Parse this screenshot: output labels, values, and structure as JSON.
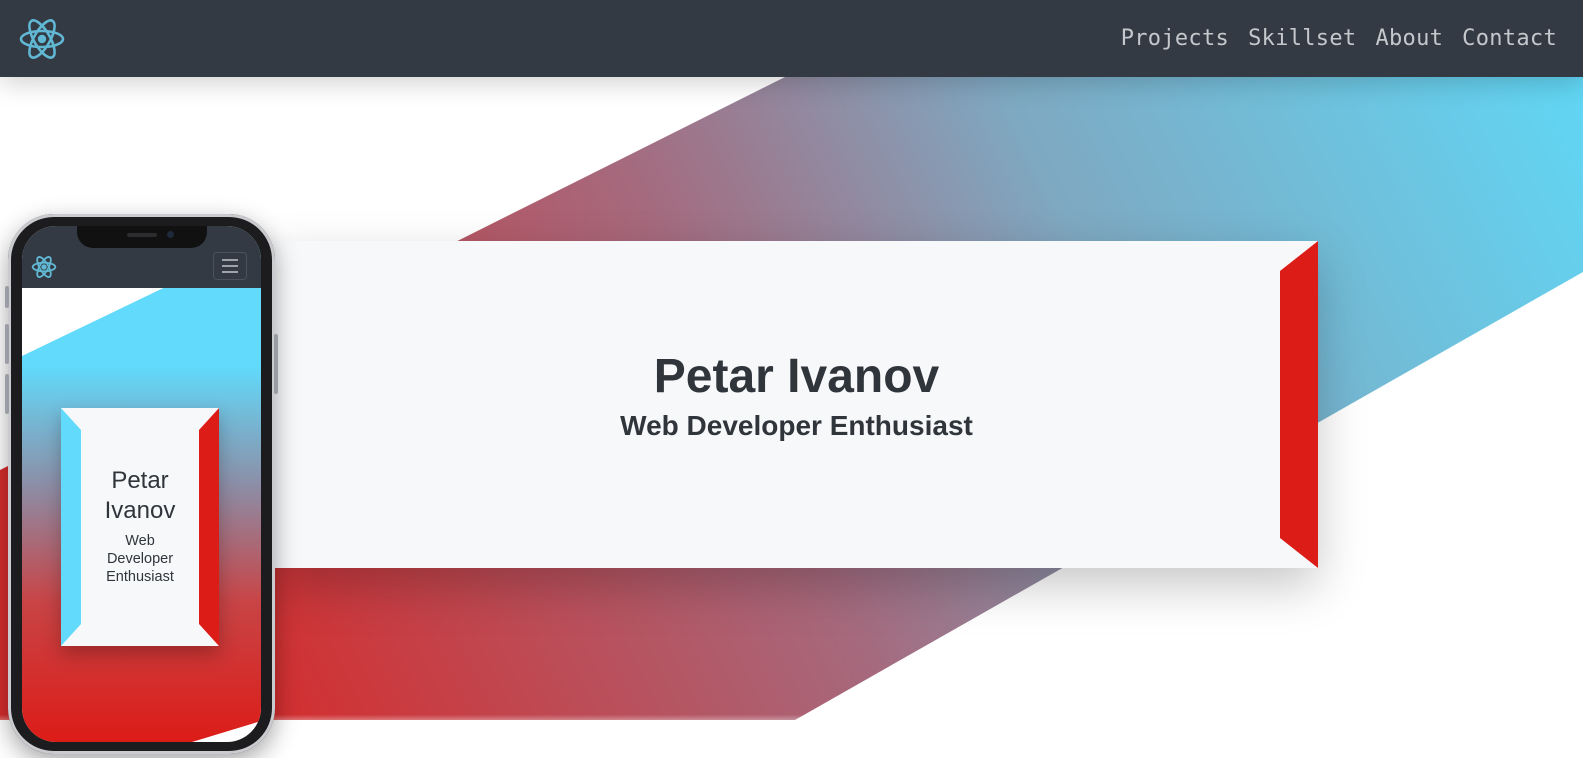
{
  "nav": {
    "logo_icon": "react-atom-icon",
    "items": [
      {
        "label": "Projects"
      },
      {
        "label": "Skillset"
      },
      {
        "label": "About"
      },
      {
        "label": "Contact"
      }
    ]
  },
  "hero": {
    "name": "Petar Ivanov",
    "role": "Web Developer Enthusiast"
  },
  "phone_preview": {
    "logo_icon": "react-atom-icon",
    "menu_icon": "hamburger-menu-icon",
    "name_line1": "Petar",
    "name_line2": "Ivanov",
    "role_line1": "Web",
    "role_line2": "Developer",
    "role_line3": "Enthusiast"
  },
  "colors": {
    "nav_bg": "#343a43",
    "nav_text": "#c4c8cd",
    "accent_blue": "#61dafb",
    "accent_red": "#dc1c17",
    "card_bg": "#f7f8fa",
    "text_dark": "#30353b"
  }
}
